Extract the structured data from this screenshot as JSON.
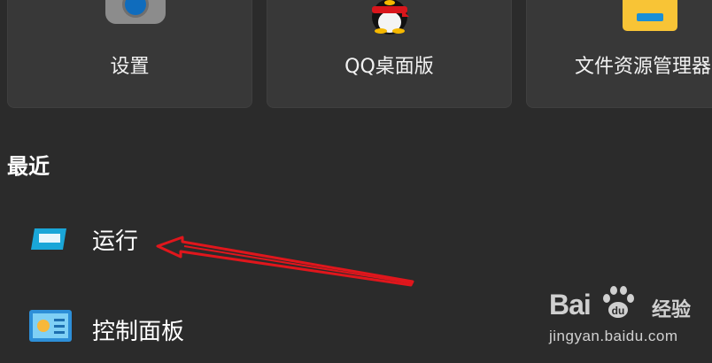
{
  "pinned": {
    "tiles": [
      {
        "label": "设置",
        "icon": "settings-gear-icon"
      },
      {
        "label": "QQ桌面版",
        "icon": "qq-penguin-icon"
      },
      {
        "label": "文件资源管理器",
        "icon": "file-explorer-folder-icon"
      }
    ]
  },
  "recent": {
    "title": "最近",
    "items": [
      {
        "label": "运行",
        "icon": "run-dialog-icon"
      },
      {
        "label": "控制面板",
        "icon": "control-panel-icon"
      }
    ]
  },
  "annotation": {
    "arrow_color": "#e0161c",
    "icon": "red-arrow-annotation"
  },
  "watermark": {
    "brand": "Bai",
    "brand2": "经验",
    "url": "jingyan.baidu.com"
  },
  "colors": {
    "background": "#2b2b2b",
    "tile": "#383838",
    "accent": "#0f6cbd"
  }
}
